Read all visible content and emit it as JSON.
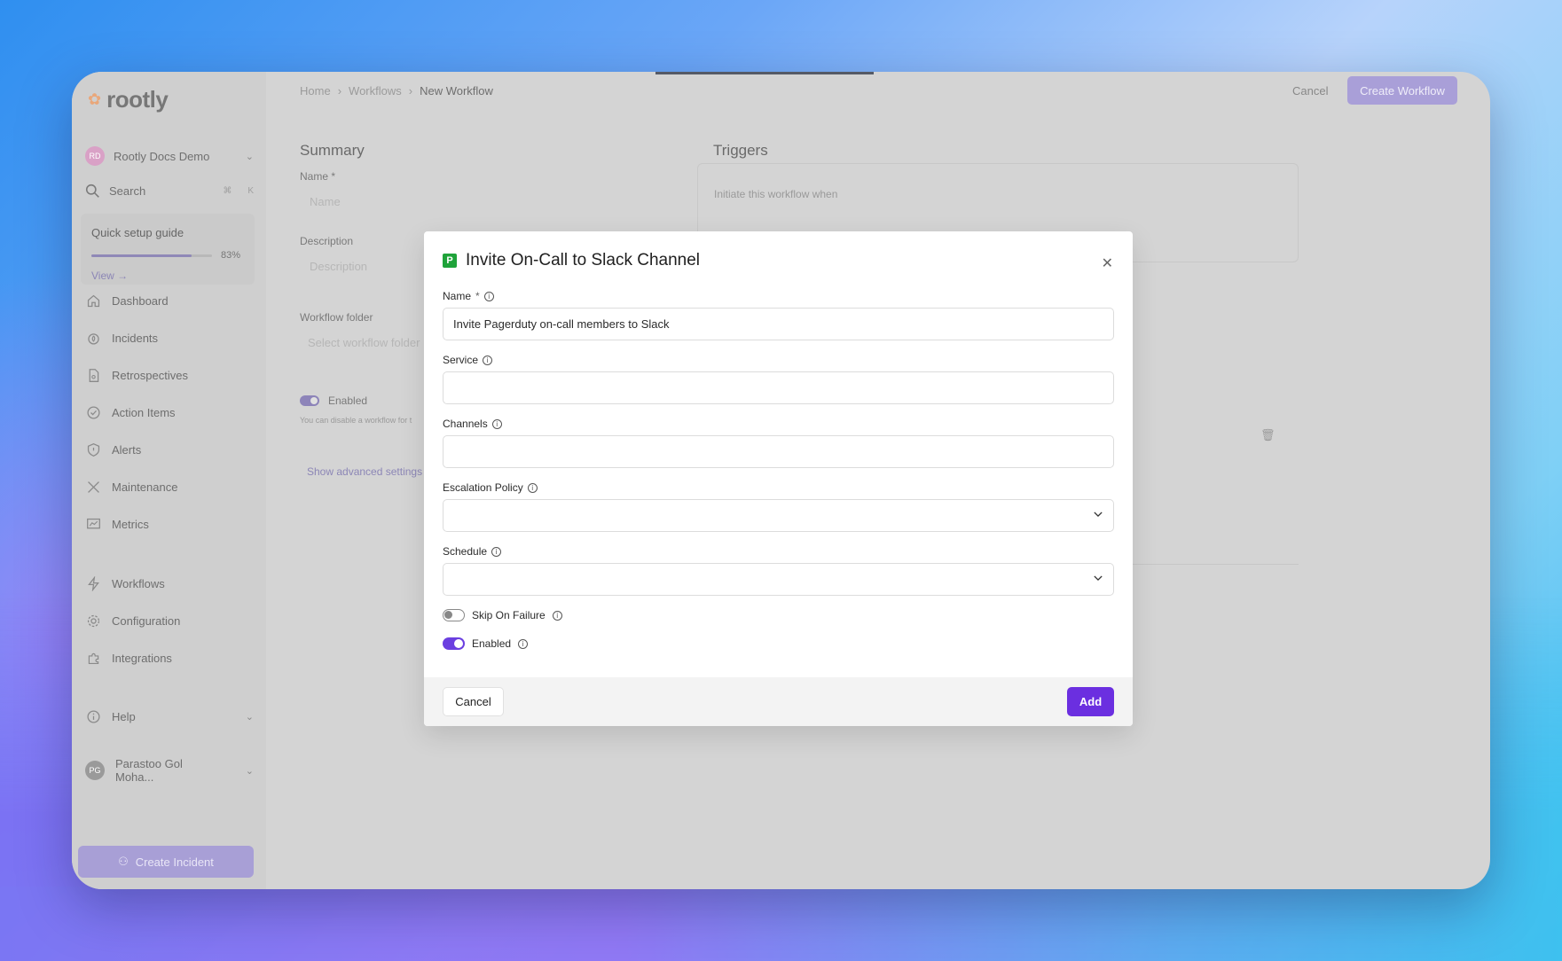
{
  "brand": {
    "name": "rootly"
  },
  "sidebar": {
    "org": {
      "avatar": "RD",
      "name": "Rootly Docs Demo"
    },
    "search": {
      "label": "Search",
      "shortcut_mod": "⌘",
      "shortcut_key": "K"
    },
    "guide": {
      "title": "Quick setup guide",
      "progress_label": "83%",
      "progress": 0.83,
      "view": "View →"
    },
    "items": [
      {
        "label": "Dashboard",
        "icon": "home-icon"
      },
      {
        "label": "Incidents",
        "icon": "fire-icon"
      },
      {
        "label": "Retrospectives",
        "icon": "doc-icon"
      },
      {
        "label": "Action Items",
        "icon": "check-circle-icon"
      },
      {
        "label": "Alerts",
        "icon": "shield-icon"
      },
      {
        "label": "Maintenance",
        "icon": "tools-icon"
      },
      {
        "label": "Metrics",
        "icon": "chart-icon"
      },
      {
        "label": "Workflows",
        "icon": "bolt-icon"
      },
      {
        "label": "Configuration",
        "icon": "gear-icon"
      },
      {
        "label": "Integrations",
        "icon": "puzzle-icon"
      }
    ],
    "help": "Help",
    "user": {
      "avatar": "PG",
      "name": "Parastoo Gol Moha..."
    },
    "create_incident": "Create Incident"
  },
  "header": {
    "breadcrumbs": [
      "Home",
      "Workflows",
      "New Workflow"
    ],
    "cancel": "Cancel",
    "create": "Create Workflow"
  },
  "summary": {
    "title": "Summary",
    "name_label": "Name *",
    "name_placeholder": "Name",
    "description_label": "Description",
    "description_placeholder": "Description",
    "folder_label": "Workflow folder",
    "folder_placeholder": "Select workflow folder",
    "enabled_label": "Enabled",
    "enabled_help": "You can disable a workflow for t",
    "advanced": "Show advanced settings"
  },
  "triggers": {
    "title": "Triggers",
    "initiate": "Initiate this workflow when"
  },
  "modal": {
    "title": "Invite On-Call to Slack Channel",
    "icon_letter": "P",
    "name_label": "Name",
    "name_required": "*",
    "name_value": "Invite Pagerduty on-call members to Slack",
    "service_label": "Service",
    "service_value": "",
    "channels_label": "Channels",
    "channels_value": "",
    "escalation_label": "Escalation Policy",
    "escalation_value": "",
    "schedule_label": "Schedule",
    "schedule_value": "",
    "skip_label": "Skip On Failure",
    "enabled_label": "Enabled",
    "cancel": "Cancel",
    "add": "Add"
  }
}
